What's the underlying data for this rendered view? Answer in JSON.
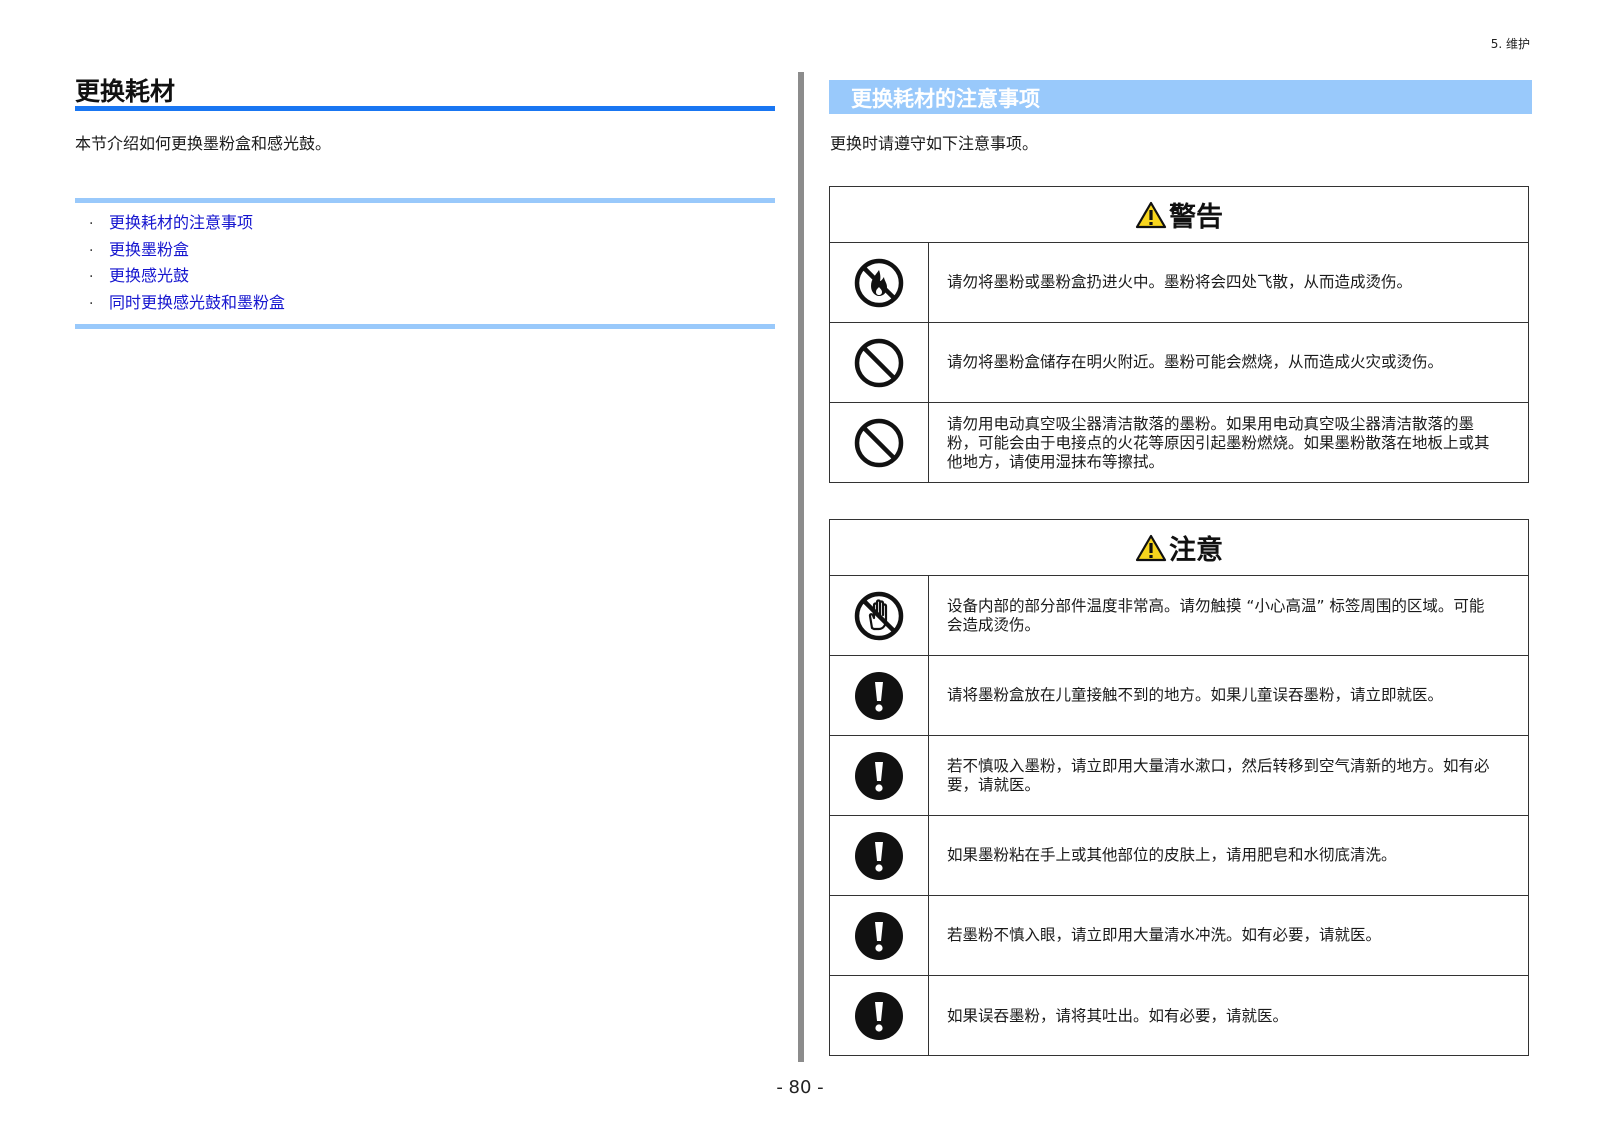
{
  "header": {
    "chapter": "5. 维护"
  },
  "left": {
    "title": "更换耗材",
    "intro": "本节介绍如何更换墨粉盒和感光鼓。",
    "toc": [
      {
        "bullet": "·",
        "label": "更换耗材的注意事项"
      },
      {
        "bullet": "·",
        "label": "更换墨粉盒"
      },
      {
        "bullet": "·",
        "label": "更换感光鼓"
      },
      {
        "bullet": "·",
        "label": "同时更换感光鼓和墨粉盒"
      }
    ]
  },
  "right": {
    "section_title": "更换耗材的注意事项",
    "intro": "更换时请遵守如下注意事项。",
    "warning": {
      "title": "警告",
      "rows": [
        {
          "icon": "no-fire-icon",
          "text": "请勿将墨粉或墨粉盒扔进火中。墨粉将会四处飞散，从而造成烫伤。"
        },
        {
          "icon": "prohibited-icon",
          "text": "请勿将墨粉盒储存在明火附近。墨粉可能会燃烧，从而造成火灾或烫伤。"
        },
        {
          "icon": "prohibited-icon",
          "text": "请勿用电动真空吸尘器清洁散落的墨粉。如果用电动真空吸尘器清洁散落的墨粉，可能会由于电接点的火花等原因引起墨粉燃烧。如果墨粉散落在地板上或其他地方，请使用湿抹布等擦拭。"
        }
      ]
    },
    "caution": {
      "title": "注意",
      "rows": [
        {
          "icon": "no-touch-icon",
          "text": "设备内部的部分部件温度非常高。请勿触摸 “小心高温” 标签周围的区域。可能会造成烫伤。"
        },
        {
          "icon": "mandatory-icon",
          "text": "请将墨粉盒放在儿童接触不到的地方。如果儿童误吞墨粉，请立即就医。"
        },
        {
          "icon": "mandatory-icon",
          "text": "若不慎吸入墨粉，请立即用大量清水漱口，然后转移到空气清新的地方。如有必要，请就医。"
        },
        {
          "icon": "mandatory-icon",
          "text": "如果墨粉粘在手上或其他部位的皮肤上，请用肥皂和水彻底清洗。"
        },
        {
          "icon": "mandatory-icon",
          "text": "若墨粉不慎入眼，请立即用大量清水冲洗。如有必要，请就医。"
        },
        {
          "icon": "mandatory-icon",
          "text": "如果误吞墨粉，请将其吐出。如有必要，请就医。"
        }
      ]
    }
  },
  "footer": {
    "page": "- 80 -"
  },
  "colors": {
    "accent": "#1976f2",
    "light_accent": "#99c9fb",
    "link": "#1515cf",
    "warning_triangle": "#f7d51d"
  }
}
